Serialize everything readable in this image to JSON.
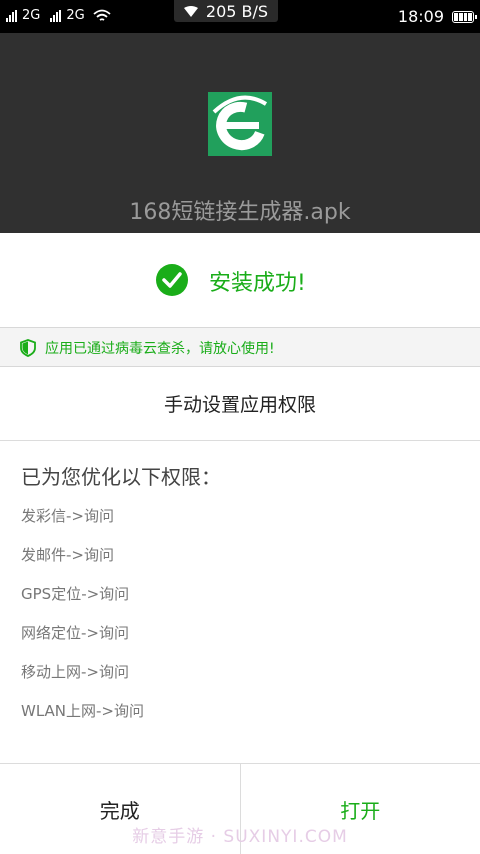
{
  "status_bar": {
    "network1": "2G",
    "network2": "2G",
    "speed": "205 B/S",
    "time": "18:09",
    "icons": [
      "signal-icon",
      "signal-icon",
      "wifi-icon",
      "battery-icon"
    ]
  },
  "app": {
    "icon": "browser-e-icon",
    "name": "168短链接生成器.apk"
  },
  "install": {
    "status": "安装成功!",
    "security_notice": "应用已通过病毒云查杀，请放心使用!"
  },
  "manual_permission_label": "手动设置应用权限",
  "optimized": {
    "title": "已为您优化以下权限：",
    "items": [
      "发彩信->询问",
      "发邮件->询问",
      "GPS定位->询问",
      "网络定位->询问",
      "移动上网->询问",
      "WLAN上网->询问"
    ]
  },
  "buttons": {
    "done": "完成",
    "open": "打开"
  },
  "watermark": "新意手游 · SUXINYI.COM",
  "colors": {
    "accent_green": "#1aad19",
    "icon_green": "#21a05c",
    "header_bg": "#303030"
  }
}
